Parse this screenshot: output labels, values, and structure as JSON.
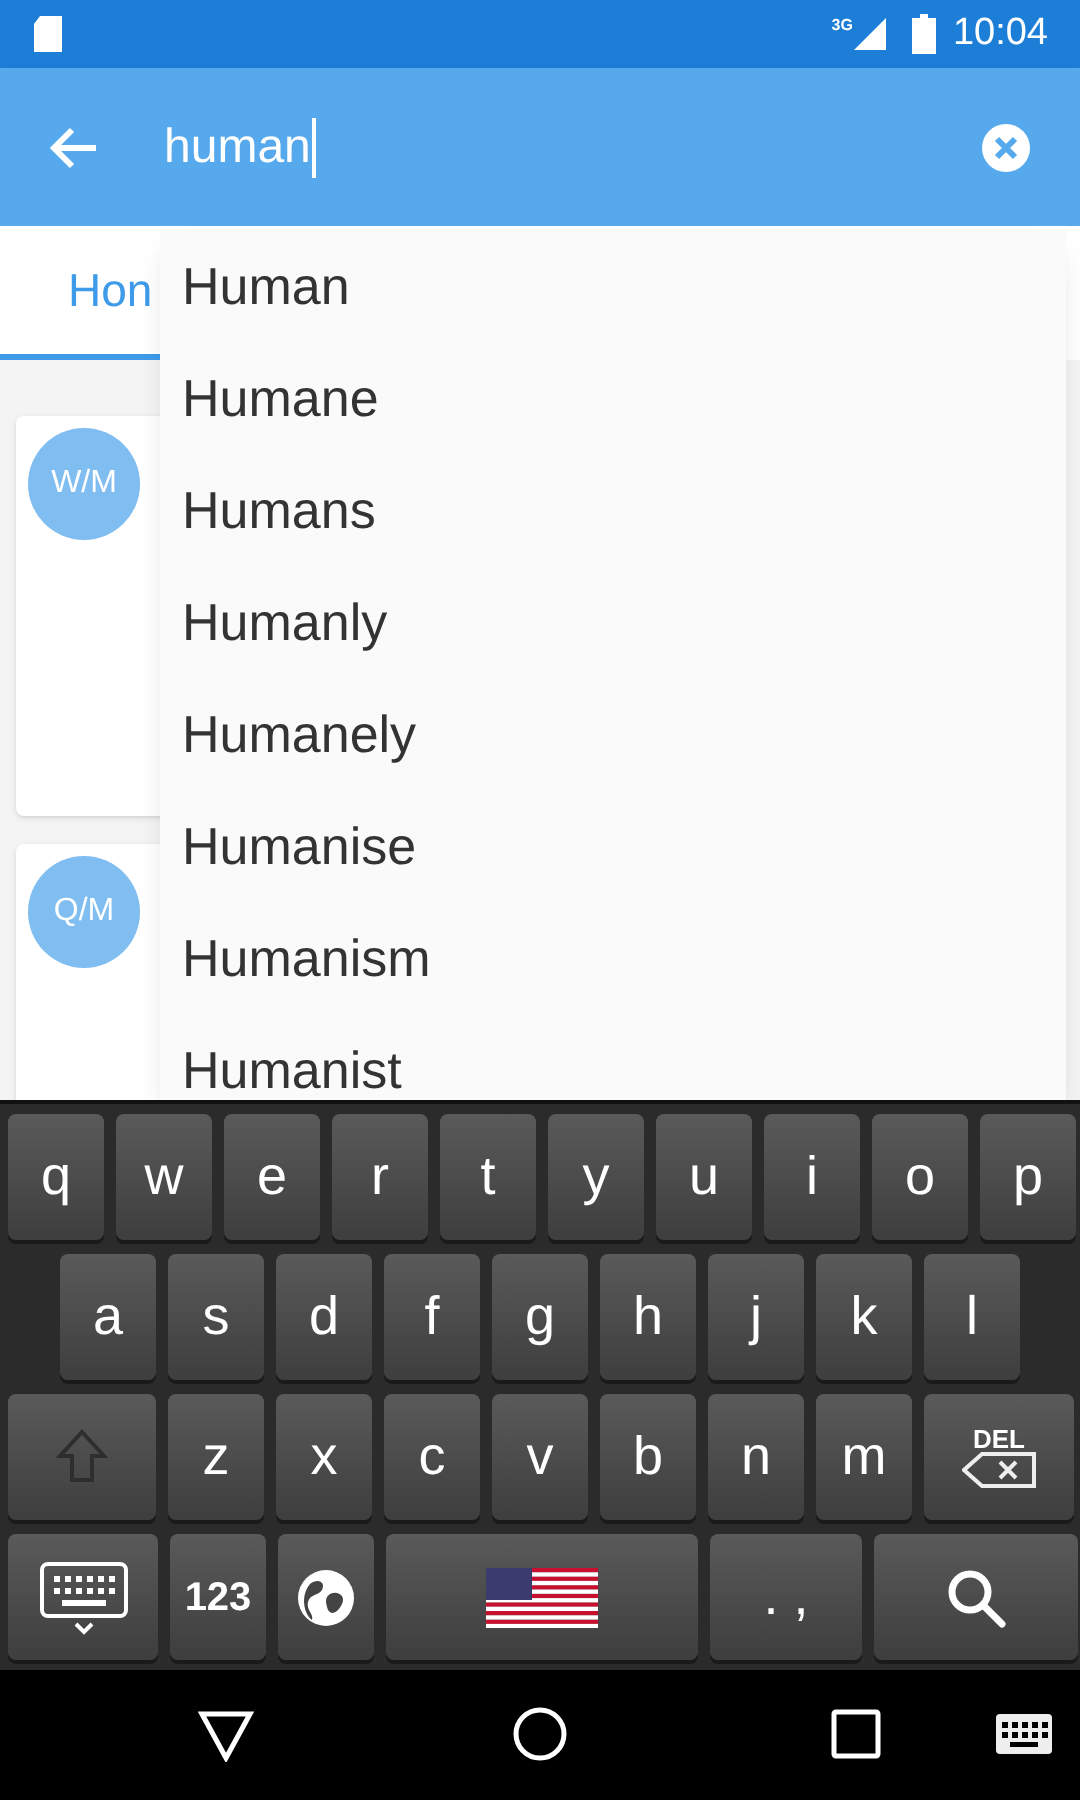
{
  "status_bar": {
    "network": "3G",
    "time": "10:04"
  },
  "search": {
    "value": "human"
  },
  "tabs": [
    {
      "label": "Hon",
      "selected": true
    }
  ],
  "cards": [
    {
      "avatar": "W/M"
    },
    {
      "avatar": "Q/M"
    }
  ],
  "suggestions": [
    "Human",
    "Humane",
    "Humans",
    "Humanly",
    "Humanely",
    "Humanise",
    "Humanism",
    "Humanist"
  ],
  "keyboard": {
    "rows": [
      [
        {
          "kind": "char",
          "label": "q"
        },
        {
          "kind": "char",
          "label": "w"
        },
        {
          "kind": "char",
          "label": "e"
        },
        {
          "kind": "char",
          "label": "r"
        },
        {
          "kind": "char",
          "label": "t"
        },
        {
          "kind": "char",
          "label": "y"
        },
        {
          "kind": "char",
          "label": "u"
        },
        {
          "kind": "char",
          "label": "i"
        },
        {
          "kind": "char",
          "label": "o"
        },
        {
          "kind": "char",
          "label": "p"
        }
      ],
      [
        {
          "kind": "char",
          "label": "a"
        },
        {
          "kind": "char",
          "label": "s"
        },
        {
          "kind": "char",
          "label": "d"
        },
        {
          "kind": "char",
          "label": "f"
        },
        {
          "kind": "char",
          "label": "g"
        },
        {
          "kind": "char",
          "label": "h"
        },
        {
          "kind": "char",
          "label": "j"
        },
        {
          "kind": "char",
          "label": "k"
        },
        {
          "kind": "char",
          "label": "l"
        }
      ],
      [
        {
          "kind": "shift",
          "disabled": true
        },
        {
          "kind": "char",
          "label": "z"
        },
        {
          "kind": "char",
          "label": "x"
        },
        {
          "kind": "char",
          "label": "c"
        },
        {
          "kind": "char",
          "label": "v"
        },
        {
          "kind": "char",
          "label": "b"
        },
        {
          "kind": "char",
          "label": "n"
        },
        {
          "kind": "char",
          "label": "m"
        },
        {
          "kind": "delete",
          "label": "DEL"
        }
      ],
      [
        {
          "kind": "hide"
        },
        {
          "kind": "symbols",
          "label": "123"
        },
        {
          "kind": "globe"
        },
        {
          "kind": "space"
        },
        {
          "kind": "punct",
          "label": ". ,"
        },
        {
          "kind": "search"
        }
      ]
    ]
  }
}
